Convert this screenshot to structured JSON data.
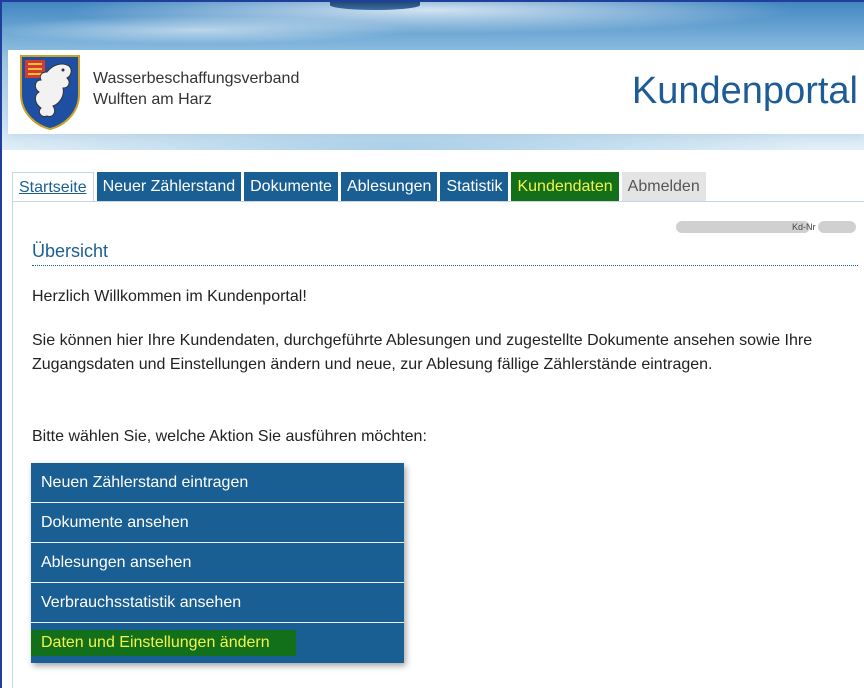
{
  "header": {
    "org_line1": "Wasserbeschaffungsverband",
    "org_line2": "Wulften am Harz",
    "portal_title": "Kundenportal"
  },
  "tabs": [
    {
      "label": "Startseite",
      "state": "active"
    },
    {
      "label": "Neuer Zählerstand"
    },
    {
      "label": "Dokumente"
    },
    {
      "label": "Ablesungen"
    },
    {
      "label": "Statistik"
    },
    {
      "label": "Kundendaten",
      "state": "highlighted"
    },
    {
      "label": "Abmelden"
    }
  ],
  "customer": {
    "kdnr_label": "Kd-Nr"
  },
  "main": {
    "section_title": "Übersicht",
    "welcome": "Herzlich Willkommen im Kundenportal!",
    "intro": "Sie können hier Ihre Kundendaten, durchgeführte Ablesungen und zugestellte Dokumente ansehen sowie Ihre Zugangsdaten und Einstellungen ändern und neue, zur Ablesung fällige Zählerstände eintragen.",
    "prompt": "Bitte wählen Sie, welche Aktion Sie ausführen möchten:",
    "actions": [
      {
        "label": "Neuen Zählerstand eintragen"
      },
      {
        "label": "Dokumente ansehen"
      },
      {
        "label": "Ablesungen ansehen"
      },
      {
        "label": "Verbrauchsstatistik ansehen"
      },
      {
        "label": "Daten und Einstellungen ändern",
        "state": "highlighted"
      }
    ]
  },
  "colors": {
    "primary": "#1a5f94",
    "highlight_bg": "#126f1a",
    "highlight_text": "#f5f34a"
  }
}
